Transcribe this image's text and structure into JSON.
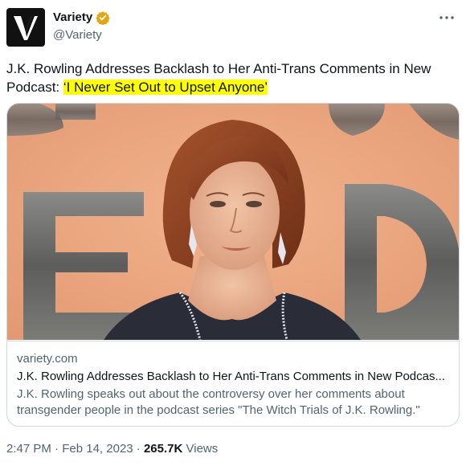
{
  "account": {
    "display_name": "Variety",
    "handle": "@Variety",
    "avatar_letter": "V",
    "verified_icon": "gold-verified-badge"
  },
  "tweet": {
    "text_plain": "J.K. Rowling Addresses Backlash to Her Anti-Trans Comments in New Podcast: ",
    "text_highlight": "‘I Never Set Out to Upset Anyone’",
    "highlight_color": "#ffff00"
  },
  "more_icon": "more-dots-icon",
  "card": {
    "domain": "variety.com",
    "title": "J.K. Rowling Addresses Backlash to Her Anti-Trans Comments in New Podcas...",
    "description": "J.K. Rowling speaks out about the controversy over her comments about transgender people in the podcast series \"The Witch Trials of J.K. Rowling.\""
  },
  "footer": {
    "time": "2:47 PM",
    "sep1": "·",
    "date": "Feb 14, 2023",
    "sep2": "·",
    "views_count": "265.7K",
    "views_label": "Views"
  },
  "colors": {
    "text": "#0f1419",
    "secondary": "#536471",
    "border": "#cfd9de",
    "badge": "#f4b400"
  }
}
